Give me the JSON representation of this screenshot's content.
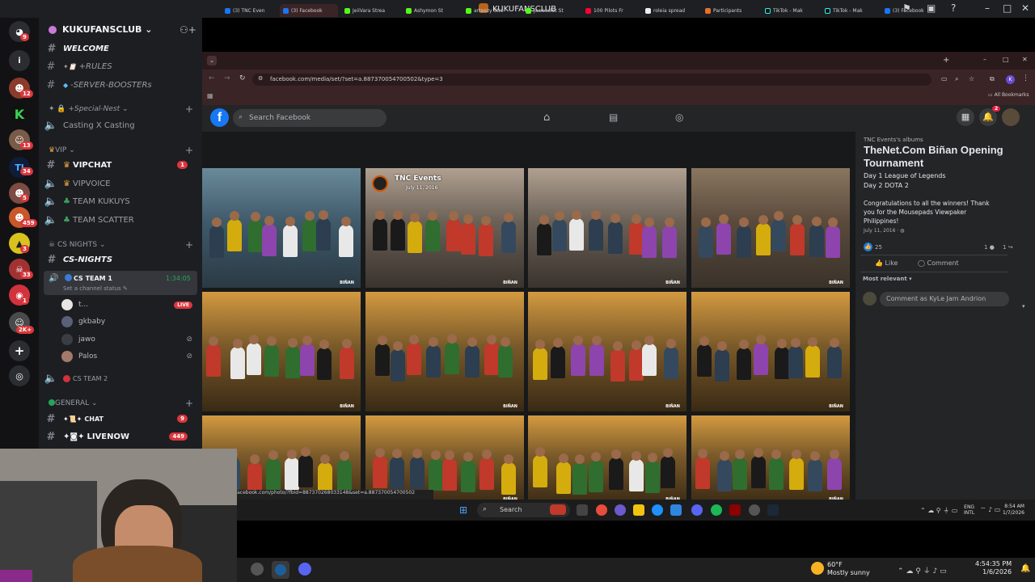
{
  "window": {
    "title": "KUKUFANSCLUB"
  },
  "server_badges": [
    "9",
    "12",
    "13",
    "34",
    "5",
    "459",
    "3",
    "33",
    "1",
    "2K+"
  ],
  "sidebar": {
    "server_name": "KUKUFANSCLUB",
    "channels_top": [
      {
        "name": "WELCOME"
      },
      {
        "name": "+RULES"
      },
      {
        "name": "-SERVER-BOOSTERs"
      }
    ],
    "category_special": "+Special-Nest",
    "casting": "Casting X Casting",
    "category_vip": "VIP",
    "vip_channels": [
      {
        "name": "VIPCHAT",
        "count": "1"
      },
      {
        "name": "VIPVOICE"
      },
      {
        "name": "TEAM KUKUYS"
      },
      {
        "name": "TEAM SCATTER"
      }
    ],
    "category_cs": "CS NIGHTS",
    "cs_nights": "CS-NIGHTS",
    "voice": {
      "name": "CS TEAM 1",
      "timer": "1:34:05",
      "status": "Set a channel status",
      "members": [
        {
          "name": "t...",
          "badge": "LIVE"
        },
        {
          "name": "gkbaby"
        },
        {
          "name": "jawo"
        },
        {
          "name": "Palos"
        }
      ]
    },
    "cs_team2": "CS TEAM 2",
    "category_general": "GENERAL",
    "general_channels": [
      {
        "name": "CHAT",
        "count": "9"
      },
      {
        "name": "LIVENOW",
        "count": "449"
      }
    ]
  },
  "browser": {
    "tabs": [
      "(3) TNC Even",
      "(3) Facebook",
      "JeiiVara Strea",
      "Ashymon St",
      "arteezy Stre",
      "jawocolet St",
      "100 Pilots Fr",
      "roleia spread",
      "Participants",
      "TikTok - Mak",
      "TikTok - Mak",
      "(3) Facebook"
    ],
    "url": "facebook.com/media/set/?set=a.887370054700502&type=3",
    "bookmarks": "All Bookmarks"
  },
  "facebook": {
    "search_placeholder": "Search Facebook",
    "notif_count": "2",
    "photo_overlay": {
      "name": "TNC Events",
      "date": "July 11, 2016"
    },
    "photo_watermark": "BIÑAN",
    "album": {
      "owner": "TNC Events's albums",
      "title": "TheNet.Com Biñan Opening Tournament",
      "line1": "Day 1 League of Legends",
      "line2": "Day 2 DOTA 2",
      "desc": "Congratulations to all the winners! Thank you for the Mousepads Viewpaker Philippines!",
      "date": "July 11, 2016 · ",
      "reactions": "25",
      "comments": "1",
      "shares": "1",
      "like": "Like",
      "comment": "Comment",
      "sort": "Most relevant",
      "comment_placeholder": "Comment as KyLe Jam Andrion"
    },
    "status_url": "facebook.com/photo/?fbid=887370268033148&set=a.887370054700502"
  },
  "taskbar": {
    "search": "Search",
    "lang1": "ENG",
    "lang2": "INTL",
    "time": "8:54 AM",
    "date": "1/7/2026"
  },
  "bottom": {
    "temp": "60°F",
    "weather": "Mostly sunny",
    "time": "4:54:35 PM",
    "date": "1/6/2026"
  },
  "colors": {
    "discord_bg": "#1d1e22",
    "fb_blue": "#1877f2",
    "live_red": "#da373c",
    "online_green": "#23a55a"
  }
}
